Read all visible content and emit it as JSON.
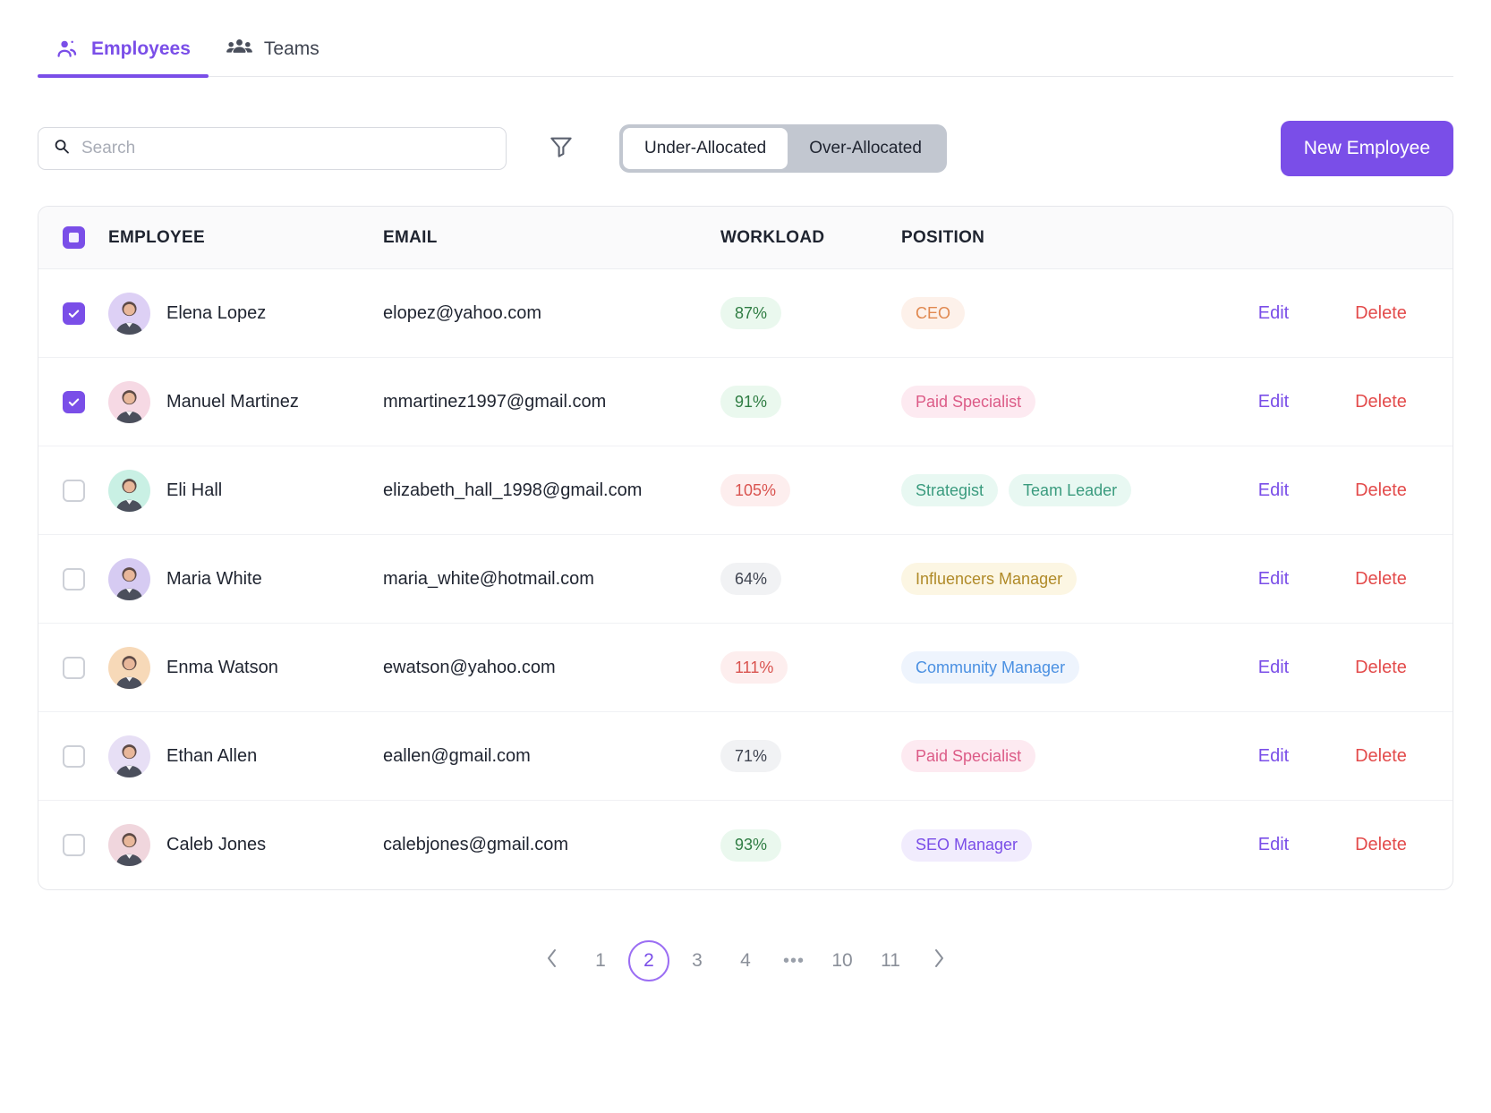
{
  "tabs": [
    {
      "label": "Employees",
      "icon": "user-single-icon",
      "active": true
    },
    {
      "label": "Teams",
      "icon": "users-group-icon",
      "active": false
    }
  ],
  "toolbar": {
    "search_placeholder": "Search",
    "search_value": "",
    "search_icon": "search-icon",
    "filter_icon": "filter-funnel-icon",
    "segments": [
      {
        "label": "Under-Allocated",
        "selected": true
      },
      {
        "label": "Over-Allocated",
        "selected": false
      }
    ],
    "new_employee_label": "New Employee",
    "accent_color": "#7a4ee8"
  },
  "table": {
    "select_all_state": "indeterminate",
    "columns": [
      "EMPLOYEE",
      "EMAIL",
      "WORKLOAD",
      "POSITION"
    ],
    "actions": {
      "edit_label": "Edit",
      "delete_label": "Delete",
      "edit_color": "#7a4ee8",
      "delete_color": "#e34b4b"
    },
    "rows": [
      {
        "selected": true,
        "name": "Elena Lopez",
        "email": "elopez@yahoo.com",
        "workload": "87%",
        "workload_tone": "green",
        "avatar_bg": "#ddd0f5",
        "positions": [
          {
            "label": "CEO",
            "tone": "orange"
          }
        ]
      },
      {
        "selected": true,
        "name": "Manuel Martinez",
        "email": "mmartinez1997@gmail.com",
        "workload": "91%",
        "workload_tone": "green",
        "avatar_bg": "#f6d9e4",
        "positions": [
          {
            "label": "Paid Specialist",
            "tone": "pink"
          }
        ]
      },
      {
        "selected": false,
        "name": "Eli Hall",
        "email": "elizabeth_hall_1998@gmail.com",
        "workload": "105%",
        "workload_tone": "red",
        "avatar_bg": "#c9f0e4",
        "positions": [
          {
            "label": "Strategist",
            "tone": "teal"
          },
          {
            "label": "Team Leader",
            "tone": "teal"
          }
        ]
      },
      {
        "selected": false,
        "name": "Maria White",
        "email": "maria_white@hotmail.com",
        "workload": "64%",
        "workload_tone": "gray",
        "avatar_bg": "#d6cbf2",
        "positions": [
          {
            "label": "Influencers Manager",
            "tone": "yellow"
          }
        ]
      },
      {
        "selected": false,
        "name": "Enma Watson",
        "email": "ewatson@yahoo.com",
        "workload": "111%",
        "workload_tone": "red",
        "avatar_bg": "#f7d9b8",
        "positions": [
          {
            "label": "Community Manager",
            "tone": "blue"
          }
        ]
      },
      {
        "selected": false,
        "name": "Ethan Allen",
        "email": "eallen@gmail.com",
        "workload": "71%",
        "workload_tone": "gray",
        "avatar_bg": "#e7dff5",
        "positions": [
          {
            "label": "Paid Specialist",
            "tone": "pink"
          }
        ]
      },
      {
        "selected": false,
        "name": "Caleb Jones",
        "email": "calebjones@gmail.com",
        "workload": "93%",
        "workload_tone": "green",
        "avatar_bg": "#f0d6dd",
        "positions": [
          {
            "label": "SEO Manager",
            "tone": "purple"
          }
        ]
      }
    ]
  },
  "pagination": {
    "prev_icon": "chevron-left-icon",
    "next_icon": "chevron-right-icon",
    "items": [
      "1",
      "2",
      "3",
      "4",
      "•••",
      "10",
      "11"
    ],
    "current_page": "2",
    "ellipsis": "•••"
  }
}
